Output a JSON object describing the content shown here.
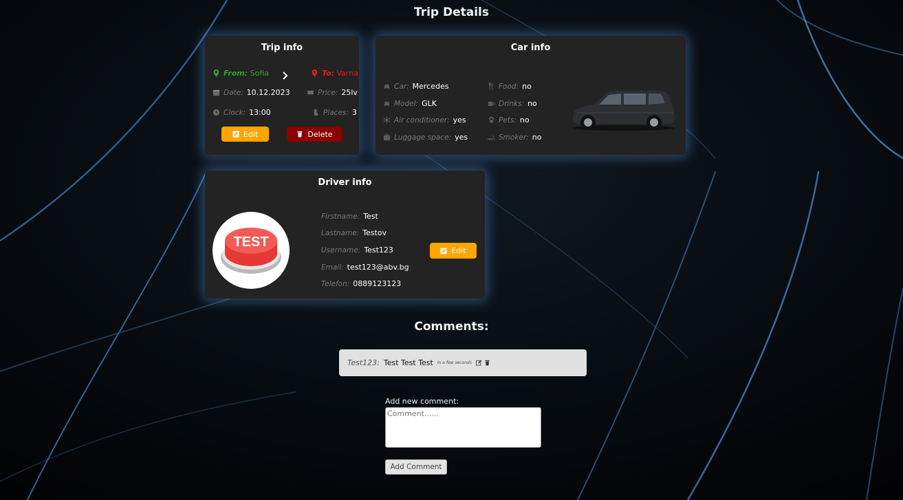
{
  "page": {
    "title": "Trip Details"
  },
  "trip": {
    "title": "Trip info",
    "from_label": "From:",
    "from_value": "Sofia",
    "to_label": "To:",
    "to_value": "Varna",
    "date_label": "Date:",
    "date_value": "10.12.2023",
    "price_label": "Price:",
    "price_value": "25lv",
    "clock_label": "Clock:",
    "clock_value": "13:00",
    "places_label": "Places:",
    "places_value": "3",
    "edit_label": "Edit",
    "delete_label": "Delete"
  },
  "car": {
    "title": "Car info",
    "car_label": "Car:",
    "car_value": "Mercedes",
    "model_label": "Model:",
    "model_value": "GLK",
    "ac_label": "Air conditioner:",
    "ac_value": "yes",
    "luggage_label": "Luggage space:",
    "luggage_value": "yes",
    "food_label": "Food:",
    "food_value": "no",
    "drinks_label": "Drinks:",
    "drinks_value": "no",
    "pets_label": "Pets:",
    "pets_value": "no",
    "smoker_label": "Smoker:",
    "smoker_value": "no"
  },
  "driver": {
    "title": "Driver info",
    "avatar_text": "TEST",
    "firstname_label": "Firstname:",
    "firstname_value": "Test",
    "lastname_label": "Lastname:",
    "lastname_value": "Testov",
    "username_label": "Username:",
    "username_value": "Test123",
    "email_label": "Email:",
    "email_value": "test123@abv.bg",
    "phone_label": "Telefon:",
    "phone_value": "0889123123",
    "edit_label": "Edit"
  },
  "comments": {
    "title": "Comments:",
    "items": [
      {
        "user": "Test123:",
        "text": "Test Test Test",
        "time": "in a few seconds"
      }
    ],
    "add_label": "Add new comment:",
    "placeholder": "Comment......",
    "submit_label": "Add Comment"
  },
  "colors": {
    "card_bg": "#232323",
    "accent_edit": "#ffa500",
    "accent_delete": "#8b0000",
    "from": "#2aa52a",
    "to": "#e21b1b",
    "glow": "#5a96dc"
  },
  "icons": [
    "map-marker-icon",
    "chevron-right-icon",
    "calendar-icon",
    "ticket-icon",
    "clock-icon",
    "seat-icon",
    "edit-icon",
    "trash-icon",
    "car-icon",
    "snowflake-icon",
    "suitcase-icon",
    "utensils-icon",
    "mug-icon",
    "paw-icon",
    "smoking-icon"
  ]
}
